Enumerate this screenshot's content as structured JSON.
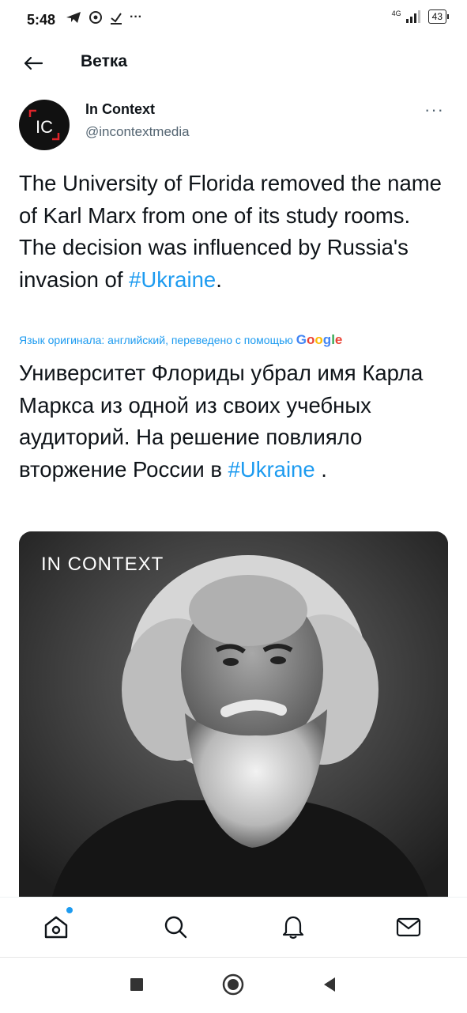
{
  "status": {
    "time": "5:48",
    "more": "···",
    "network": "4G",
    "battery": "43"
  },
  "header": {
    "title": "Ветка"
  },
  "tweet": {
    "author_name": "In Context",
    "author_handle": "@incontextmedia",
    "avatar_text": "IC",
    "more_label": "···",
    "text_before_tag": "The University of Florida removed the name of Karl Marx from one of its study rooms. The decision was influenced by Russia's invasion of ",
    "hashtag": "#Ukraine",
    "text_after_tag": ".",
    "translation_label": "Язык оригинала: английский, переведено с помощью",
    "translation_provider": "Google",
    "translated_before_tag": "Университет Флориды убрал имя Карла Маркса из одной из своих учебных аудиторий. На решение повлияло вторжение России в ",
    "translated_hashtag": "#Ukraine",
    "translated_after_tag": " .",
    "image_watermark": "IN CONTEXT"
  },
  "bottom_nav": {
    "items": [
      "home-icon",
      "search-icon",
      "notifications-icon",
      "messages-icon"
    ],
    "home_has_new": true
  },
  "colors": {
    "accent": "#1d9bf0",
    "text": "#0f1419",
    "muted": "#536471"
  }
}
